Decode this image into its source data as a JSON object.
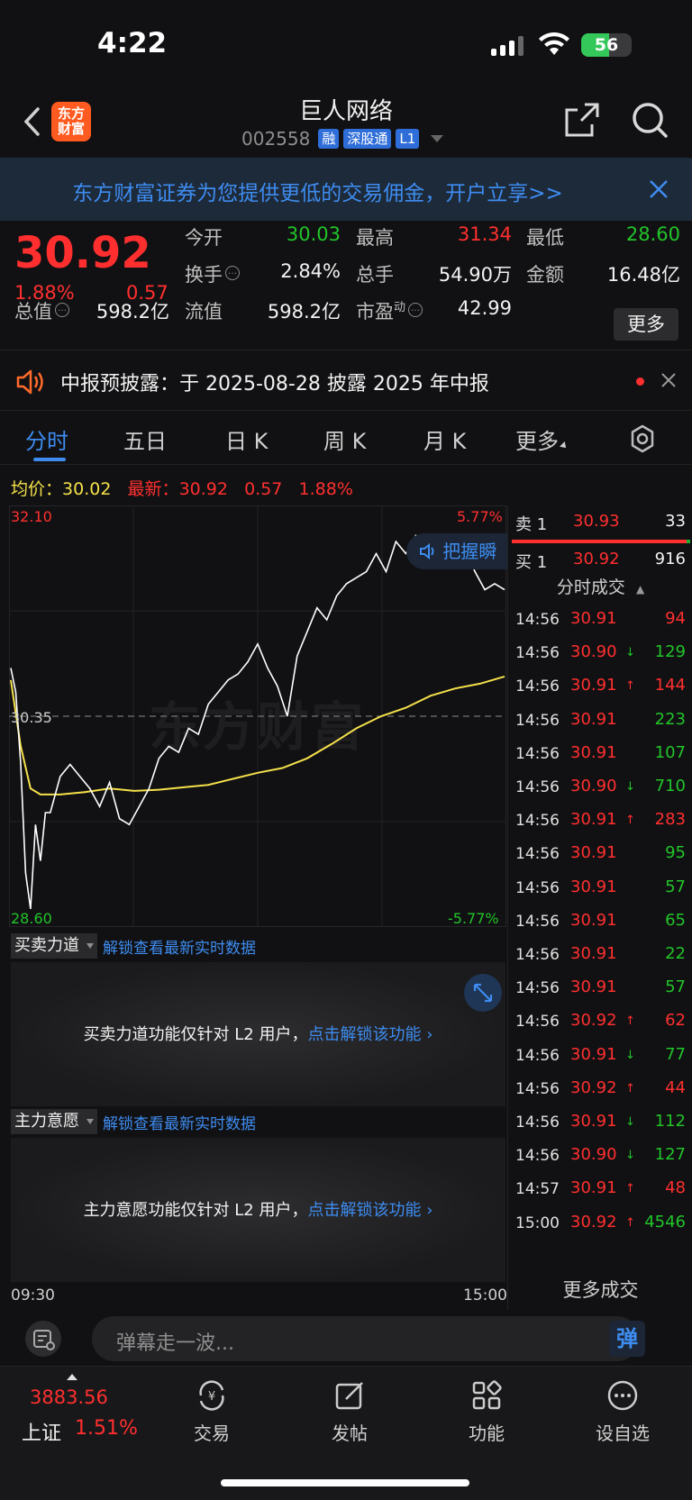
{
  "status": {
    "time": "4:22",
    "battery": "56",
    "battery_level": 0.56
  },
  "header": {
    "title": "巨人网络",
    "code": "002558",
    "tags": [
      "融",
      "深股通",
      "L1"
    ],
    "logo_text": "东方\n财富"
  },
  "banner": {
    "text": "东方财富证券为您提供更低的交易佣金，开户立享>>"
  },
  "quote": {
    "price": "30.92",
    "pct": "1.88%",
    "change": "0.57",
    "open_label": "今开",
    "open": "30.03",
    "high_label": "最高",
    "high": "31.34",
    "low_label": "最低",
    "low": "28.60",
    "turnover_label": "换手",
    "turnover": "2.84%",
    "volume_label": "总手",
    "volume": "54.90万",
    "amount_label": "金额",
    "amount": "16.48亿",
    "mktcap_label": "总值",
    "mktcap": "598.2亿",
    "float_label": "流值",
    "float": "598.2亿",
    "pe_label": "市盈",
    "pe_sup": "动",
    "pe": "42.99",
    "more_label": "更多"
  },
  "notice": {
    "text": "中报预披露：于 2025-08-28 披露 2025 年中报"
  },
  "tabs": [
    "分时",
    "五日",
    "日 K",
    "周 K",
    "月 K",
    "更多"
  ],
  "avg": {
    "avg_label": "均价：",
    "avg_value": "30.02",
    "latest_label": "最新：",
    "latest_value": "30.92",
    "latest_change": "0.57",
    "latest_pct": "1.88%"
  },
  "chart_data": {
    "type": "line",
    "title": "",
    "y_top": "32.10",
    "y_top_pct": "5.77%",
    "y_mid": "30.35",
    "y_bottom": "28.60",
    "y_bottom_pct": "-5.77%",
    "ylim": [
      28.6,
      32.1
    ],
    "baseline": 30.35,
    "x_start": "09:30",
    "x_end": "15:00",
    "series": [
      {
        "x": [
          0,
          0.01,
          0.02,
          0.03,
          0.04,
          0.05,
          0.06,
          0.07,
          0.08,
          0.1,
          0.12,
          0.14,
          0.16,
          0.18,
          0.2,
          0.22,
          0.24,
          0.26,
          0.28,
          0.3,
          0.32,
          0.34,
          0.36,
          0.38,
          0.4,
          0.42,
          0.44,
          0.46,
          0.48,
          0.5,
          0.52,
          0.54,
          0.56,
          0.58,
          0.6,
          0.62,
          0.64,
          0.66,
          0.68,
          0.7,
          0.72,
          0.74,
          0.76,
          0.78,
          0.8,
          0.82,
          0.84,
          0.86,
          0.88,
          0.9,
          0.92,
          0.94,
          0.96,
          0.98,
          1.0
        ],
        "values": [
          30.75,
          30.55,
          29.95,
          29.05,
          28.75,
          29.45,
          29.15,
          29.55,
          29.55,
          29.85,
          29.95,
          29.85,
          29.75,
          29.6,
          29.8,
          29.5,
          29.45,
          29.6,
          29.75,
          30.0,
          30.1,
          30.05,
          30.25,
          30.2,
          30.45,
          30.55,
          30.65,
          30.7,
          30.8,
          30.95,
          30.75,
          30.6,
          30.35,
          30.85,
          31.05,
          31.25,
          31.15,
          31.35,
          31.45,
          31.5,
          31.55,
          31.7,
          31.55,
          31.8,
          31.7,
          31.85,
          31.75,
          31.8,
          31.6,
          31.65,
          31.75,
          31.55,
          31.4,
          31.45,
          31.4
        ]
      },
      {
        "x": [
          0,
          0.02,
          0.04,
          0.06,
          0.1,
          0.15,
          0.2,
          0.25,
          0.3,
          0.35,
          0.4,
          0.45,
          0.5,
          0.55,
          0.6,
          0.65,
          0.7,
          0.75,
          0.8,
          0.85,
          0.9,
          0.95,
          1.0
        ],
        "values": [
          30.65,
          30.1,
          29.75,
          29.7,
          29.7,
          29.72,
          29.75,
          29.73,
          29.74,
          29.76,
          29.78,
          29.83,
          29.88,
          29.92,
          30.0,
          30.12,
          30.25,
          30.35,
          30.42,
          30.52,
          30.58,
          30.62,
          30.68
        ]
      }
    ]
  },
  "subpanels": [
    {
      "title": "买卖力道",
      "link": "解锁查看最新实时数据",
      "msg": "买卖力道功能仅针对 L2 用户，",
      "action": "点击解锁该功能"
    },
    {
      "title": "主力意愿",
      "link": "解锁查看最新实时数据",
      "msg": "主力意愿功能仅针对 L2 用户，",
      "action": "点击解锁该功能"
    }
  ],
  "book": {
    "sell": {
      "label": "卖 1",
      "price": "30.93",
      "vol": "33"
    },
    "buy": {
      "label": "买 1",
      "price": "30.92",
      "vol": "916"
    },
    "ticks_header": "分时成交",
    "more": "更多成交",
    "ticks": [
      {
        "time": "14:56",
        "price": "30.91",
        "dir": "",
        "vol": "94",
        "color": "red"
      },
      {
        "time": "14:56",
        "price": "30.90",
        "dir": "↓",
        "vol": "129",
        "color": "green"
      },
      {
        "time": "14:56",
        "price": "30.91",
        "dir": "↑",
        "vol": "144",
        "color": "red"
      },
      {
        "time": "14:56",
        "price": "30.91",
        "dir": "",
        "vol": "223",
        "color": "green"
      },
      {
        "time": "14:56",
        "price": "30.91",
        "dir": "",
        "vol": "107",
        "color": "green"
      },
      {
        "time": "14:56",
        "price": "30.90",
        "dir": "↓",
        "vol": "710",
        "color": "green"
      },
      {
        "time": "14:56",
        "price": "30.91",
        "dir": "↑",
        "vol": "283",
        "color": "red"
      },
      {
        "time": "14:56",
        "price": "30.91",
        "dir": "",
        "vol": "95",
        "color": "green"
      },
      {
        "time": "14:56",
        "price": "30.91",
        "dir": "",
        "vol": "57",
        "color": "green"
      },
      {
        "time": "14:56",
        "price": "30.91",
        "dir": "",
        "vol": "65",
        "color": "green"
      },
      {
        "time": "14:56",
        "price": "30.91",
        "dir": "",
        "vol": "22",
        "color": "green"
      },
      {
        "time": "14:56",
        "price": "30.91",
        "dir": "",
        "vol": "57",
        "color": "green"
      },
      {
        "time": "14:56",
        "price": "30.92",
        "dir": "↑",
        "vol": "62",
        "color": "red"
      },
      {
        "time": "14:56",
        "price": "30.91",
        "dir": "↓",
        "vol": "77",
        "color": "green"
      },
      {
        "time": "14:56",
        "price": "30.92",
        "dir": "↑",
        "vol": "44",
        "color": "red"
      },
      {
        "time": "14:56",
        "price": "30.91",
        "dir": "↓",
        "vol": "112",
        "color": "green"
      },
      {
        "time": "14:56",
        "price": "30.90",
        "dir": "↓",
        "vol": "127",
        "color": "green"
      },
      {
        "time": "14:57",
        "price": "30.91",
        "dir": "↑",
        "vol": "48",
        "color": "red"
      },
      {
        "time": "15:00",
        "price": "30.92",
        "dir": "↑",
        "vol": "4546",
        "color": "green"
      }
    ]
  },
  "comment": {
    "placeholder": "弹幕走一波...",
    "danmu": "弹"
  },
  "bottom": {
    "index_value": "3883.56",
    "index_name": "上证",
    "index_pct": "1.51%",
    "nav": [
      "交易",
      "发帖",
      "功能",
      "设自选"
    ]
  },
  "watermark": "东方财富",
  "grasp": "把握瞬"
}
